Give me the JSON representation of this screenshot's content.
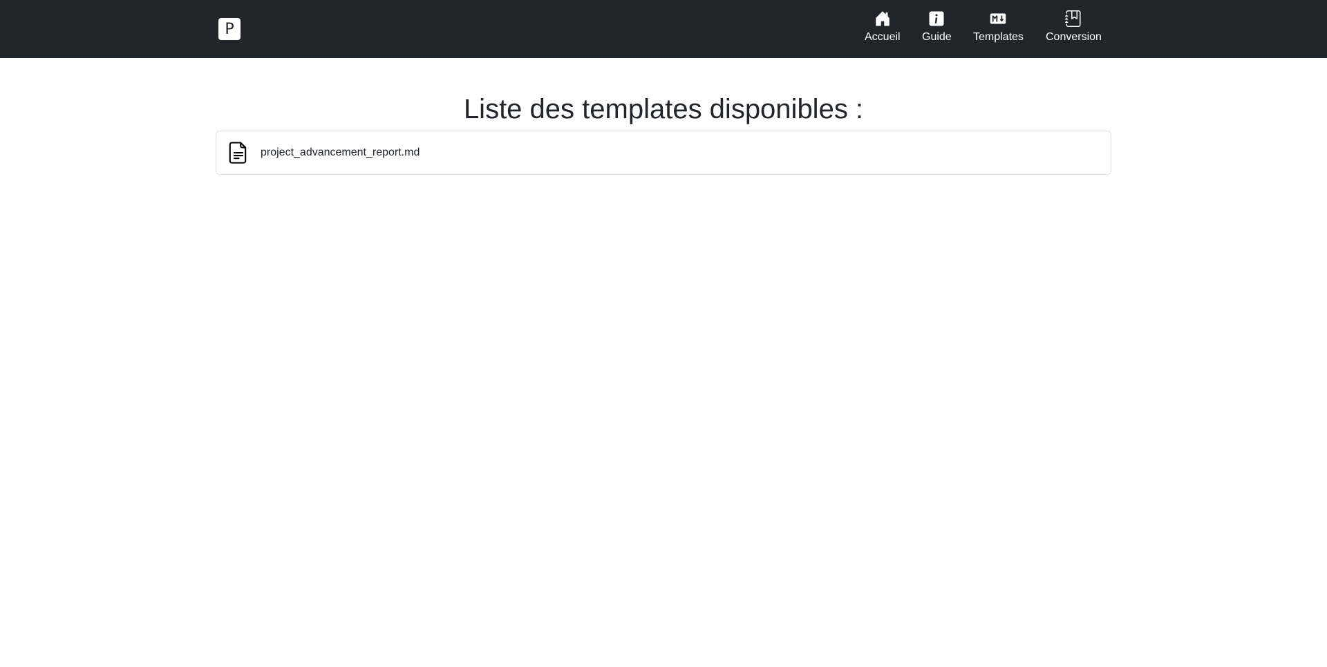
{
  "header": {
    "brand_letter": "P",
    "nav": [
      {
        "label": "Accueil",
        "icon": "home-icon"
      },
      {
        "label": "Guide",
        "icon": "info-icon"
      },
      {
        "label": "Templates",
        "icon": "markdown-icon"
      },
      {
        "label": "Conversion",
        "icon": "journal-bookmark-icon"
      }
    ],
    "background_color": "#212529"
  },
  "main": {
    "title": "Liste des templates disponibles :",
    "templates": [
      {
        "file_name": "project_advancement_report.md",
        "icon": "file-text-icon"
      }
    ]
  }
}
